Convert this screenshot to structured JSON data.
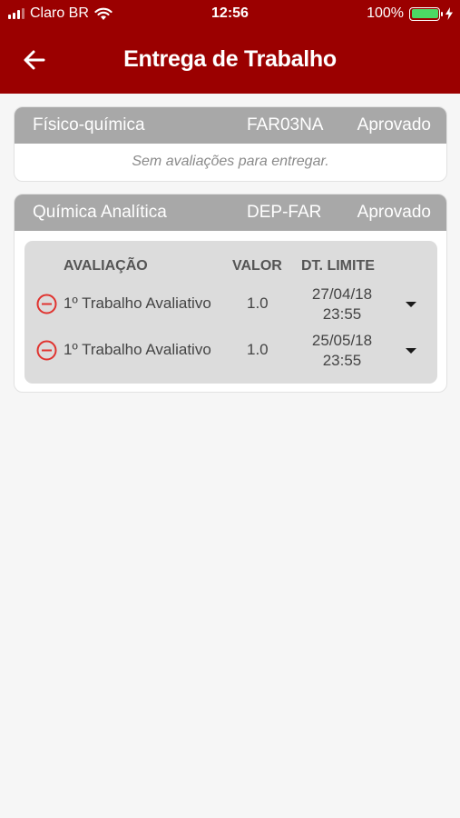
{
  "status_bar": {
    "carrier": "Claro BR",
    "time": "12:56",
    "battery_percent": "100%",
    "battery_level": 1.0,
    "battery_color": "#4cd964"
  },
  "header": {
    "title": "Entrega de Trabalho",
    "back_icon": "arrow-left-icon",
    "background_color": "#9b0000"
  },
  "courses": [
    {
      "name": "Físico-química",
      "code": "FAR03NA",
      "status": "Aprovado",
      "empty_message": "Sem avaliações para entregar."
    },
    {
      "name": "Química Analítica",
      "code": "DEP-FAR",
      "status": "Aprovado",
      "columns": {
        "avaliacao": "AVALIAÇÃO",
        "valor": "VALOR",
        "dt_limite": "DT. LIMITE"
      },
      "evaluations": [
        {
          "name": "1º Trabalho Avaliativo",
          "valor": "1.0",
          "date": "27/04/18",
          "time": "23:55"
        },
        {
          "name": "1º Trabalho Avaliativo",
          "valor": "1.0",
          "date": "25/05/18",
          "time": "23:55"
        }
      ]
    }
  ],
  "colors": {
    "remove_icon": "#e0332f",
    "card_header": "#a8a8a8"
  }
}
